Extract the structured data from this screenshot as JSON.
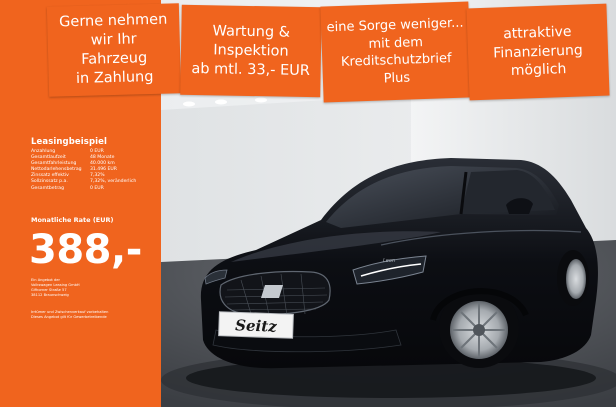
{
  "tags": [
    {
      "lines": [
        "Gerne nehmen",
        "wir Ihr",
        "Fahrzeug",
        "in Zahlung"
      ]
    },
    {
      "lines": [
        "Wartung &",
        "Inspektion",
        "ab mtl. 33,- EUR"
      ]
    },
    {
      "lines": [
        "eine Sorge weniger...",
        "mit dem",
        "Kreditschutzbrief",
        "Plus"
      ]
    },
    {
      "lines": [
        "attraktive",
        "Finanzierung",
        "möglich"
      ]
    }
  ],
  "leasing": {
    "title": "Leasingbeispiel",
    "rows": [
      {
        "label": "Anzahlung",
        "value": "0 EUR"
      },
      {
        "label": "Gesamtlaufzeit",
        "value": "48 Monate"
      },
      {
        "label": "Gesamtfahrleistung",
        "value": "40.000 km"
      },
      {
        "label": "Nettodarlehensbetrag",
        "value": "31.496 EUR"
      },
      {
        "label": "Zinssatz effektiv",
        "value": "7,32%"
      },
      {
        "label": "Sollzinssatz p.a.",
        "value": "7,32%, veränderlich"
      },
      {
        "label": "Gesamtbetrag",
        "value": "0 EUR"
      }
    ],
    "rate_label": "Monatliche Rate (EUR)",
    "price": "388,-",
    "provider_lines": [
      "Ein Angebot der",
      "Volkswagen Leasing GmbH",
      "Gifhorner Straße 57",
      "38112 Braunschweig"
    ],
    "disclaimer_lines": [
      "Irrtümer und Zwischenverkauf vorbehalten",
      "Dieses Angebot gilt für Gewerbetreibende"
    ]
  },
  "vehicle": {
    "plate_text": "Seitz",
    "badge_text": "Leon"
  },
  "colors": {
    "brand_orange": "#f0641e",
    "car_body": "#0d0f14",
    "wall": "#e9ebec",
    "floor": "#4a4d52"
  }
}
